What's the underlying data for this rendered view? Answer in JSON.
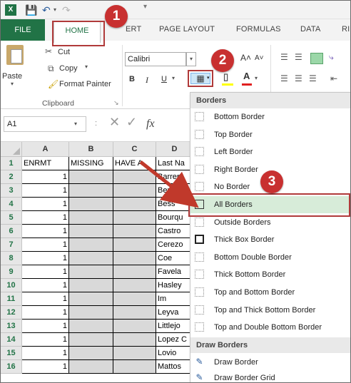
{
  "app": {
    "logo_text": "X",
    "accent_color": "#217346"
  },
  "tabs": {
    "file": "FILE",
    "home": "HOME",
    "insert_partial": "ERT",
    "page_layout": "PAGE LAYOUT",
    "formulas": "FORMULAS",
    "data": "DATA",
    "review_partial": "RI"
  },
  "ribbon": {
    "clipboard": {
      "cut": "Cut",
      "copy": "Copy",
      "paste": "Paste",
      "format_painter": "Format Painter",
      "group_label": "Clipboard"
    },
    "font": {
      "font_name": "Calibri",
      "bold": "B",
      "italic": "I",
      "underline": "U",
      "group_label_partial": "F"
    }
  },
  "formula_bar": {
    "name_box": "A1",
    "fx": "fx",
    "separator": ":"
  },
  "sheet": {
    "columns": [
      "A",
      "B",
      "C",
      "D"
    ],
    "headers": [
      "ENRMT",
      "MISSING",
      "HAVE A",
      "Last Na"
    ],
    "rows": [
      {
        "n": "1",
        "a": "ENRMT",
        "b": "MISSING",
        "c": "HAVE A",
        "d": "Last Na"
      },
      {
        "n": "2",
        "a": "1",
        "d": "Barrera"
      },
      {
        "n": "3",
        "a": "1",
        "d": "Berpo"
      },
      {
        "n": "4",
        "a": "1",
        "d": "Bess"
      },
      {
        "n": "5",
        "a": "1",
        "d": "Bourqu"
      },
      {
        "n": "6",
        "a": "1",
        "d": "Castro"
      },
      {
        "n": "7",
        "a": "1",
        "d": "Cerezo"
      },
      {
        "n": "8",
        "a": "1",
        "d": "Coe"
      },
      {
        "n": "9",
        "a": "1",
        "d": "Favela"
      },
      {
        "n": "10",
        "a": "1",
        "d": "Hasley"
      },
      {
        "n": "11",
        "a": "1",
        "d": "Im"
      },
      {
        "n": "12",
        "a": "1",
        "d": "Leyva"
      },
      {
        "n": "13",
        "a": "1",
        "d": "Littlejo"
      },
      {
        "n": "14",
        "a": "1",
        "d": "Lopez C"
      },
      {
        "n": "15",
        "a": "1",
        "d": "Lovio"
      },
      {
        "n": "16",
        "a": "1",
        "d": "Mattos"
      }
    ]
  },
  "borders_menu": {
    "section_borders": "Borders",
    "items": [
      {
        "label": "Bottom Border",
        "icon": "bottom-border-icon"
      },
      {
        "label": "Top Border",
        "icon": "top-border-icon"
      },
      {
        "label": "Left Border",
        "icon": "left-border-icon"
      },
      {
        "label": "Right Border",
        "icon": "right-border-icon"
      },
      {
        "label": "No Border",
        "icon": "no-border-icon"
      },
      {
        "label": "All Borders",
        "icon": "all-borders-icon"
      },
      {
        "label": "Outside Borders",
        "icon": "outside-borders-icon"
      },
      {
        "label": "Thick Box Border",
        "icon": "thick-box-border-icon"
      },
      {
        "label": "Bottom Double Border",
        "icon": "bottom-double-border-icon"
      },
      {
        "label": "Thick Bottom Border",
        "icon": "thick-bottom-border-icon"
      },
      {
        "label": "Top and Bottom Border",
        "icon": "top-bottom-border-icon"
      },
      {
        "label": "Top and Thick Bottom Border",
        "icon": "top-thick-bottom-border-icon"
      },
      {
        "label": "Top and Double Bottom Border",
        "icon": "top-double-bottom-border-icon"
      }
    ],
    "section_draw": "Draw Borders",
    "draw_items": [
      {
        "label": "Draw Border",
        "icon": "pencil-icon"
      },
      {
        "label": "Draw Border Grid",
        "icon": "pencil-grid-icon"
      }
    ]
  },
  "callouts": [
    "1",
    "2",
    "3"
  ]
}
